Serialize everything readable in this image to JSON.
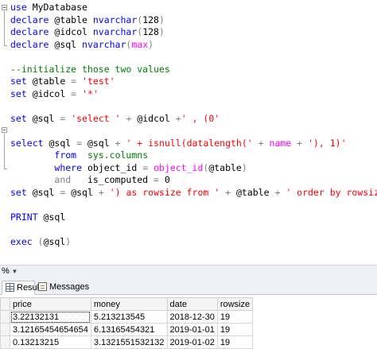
{
  "editor": {
    "lines": [
      [
        {
          "t": "kw",
          "v": "use"
        },
        {
          "t": "plain",
          "v": " MyDatabase"
        }
      ],
      [
        {
          "t": "kw",
          "v": "declare"
        },
        {
          "t": "plain",
          "v": " @table "
        },
        {
          "t": "kw",
          "v": "nvarchar"
        },
        {
          "t": "gray",
          "v": "("
        },
        {
          "t": "plain",
          "v": "128"
        },
        {
          "t": "gray",
          "v": ")"
        }
      ],
      [
        {
          "t": "kw",
          "v": "declare"
        },
        {
          "t": "plain",
          "v": " @idcol "
        },
        {
          "t": "kw",
          "v": "nvarchar"
        },
        {
          "t": "gray",
          "v": "("
        },
        {
          "t": "plain",
          "v": "128"
        },
        {
          "t": "gray",
          "v": ")"
        }
      ],
      [
        {
          "t": "kw",
          "v": "declare"
        },
        {
          "t": "plain",
          "v": " @sql "
        },
        {
          "t": "kw",
          "v": "nvarchar"
        },
        {
          "t": "gray",
          "v": "("
        },
        {
          "t": "fn",
          "v": "max"
        },
        {
          "t": "gray",
          "v": ")"
        }
      ],
      [],
      [
        {
          "t": "cmt",
          "v": "--initialize those two values"
        }
      ],
      [
        {
          "t": "kw",
          "v": "set"
        },
        {
          "t": "plain",
          "v": " @table "
        },
        {
          "t": "gray",
          "v": "="
        },
        {
          "t": "plain",
          "v": " "
        },
        {
          "t": "str",
          "v": "'test'"
        }
      ],
      [
        {
          "t": "kw",
          "v": "set"
        },
        {
          "t": "plain",
          "v": " @idcol "
        },
        {
          "t": "gray",
          "v": "="
        },
        {
          "t": "plain",
          "v": " "
        },
        {
          "t": "str",
          "v": "'*'"
        }
      ],
      [],
      [
        {
          "t": "kw",
          "v": "set"
        },
        {
          "t": "plain",
          "v": " @sql "
        },
        {
          "t": "gray",
          "v": "="
        },
        {
          "t": "plain",
          "v": " "
        },
        {
          "t": "str",
          "v": "'select '"
        },
        {
          "t": "plain",
          "v": " "
        },
        {
          "t": "gray",
          "v": "+"
        },
        {
          "t": "plain",
          "v": " @idcol "
        },
        {
          "t": "gray",
          "v": "+"
        },
        {
          "t": "str",
          "v": "' , (0'"
        }
      ],
      [],
      [
        {
          "t": "kw",
          "v": "select"
        },
        {
          "t": "plain",
          "v": " @sql "
        },
        {
          "t": "gray",
          "v": "="
        },
        {
          "t": "plain",
          "v": " @sql "
        },
        {
          "t": "gray",
          "v": "+"
        },
        {
          "t": "plain",
          "v": " "
        },
        {
          "t": "str",
          "v": "' + isnull(datalength('"
        },
        {
          "t": "plain",
          "v": " "
        },
        {
          "t": "gray",
          "v": "+"
        },
        {
          "t": "plain",
          "v": " "
        },
        {
          "t": "fn",
          "v": "name"
        },
        {
          "t": "plain",
          "v": " "
        },
        {
          "t": "gray",
          "v": "+"
        },
        {
          "t": "plain",
          "v": " "
        },
        {
          "t": "str",
          "v": "'), 1)'"
        }
      ],
      [
        {
          "t": "plain",
          "v": "        "
        },
        {
          "t": "kw",
          "v": "from"
        },
        {
          "t": "plain",
          "v": "  "
        },
        {
          "t": "sys",
          "v": "sys.columns"
        }
      ],
      [
        {
          "t": "plain",
          "v": "        "
        },
        {
          "t": "kw",
          "v": "where"
        },
        {
          "t": "plain",
          "v": " object_id "
        },
        {
          "t": "gray",
          "v": "="
        },
        {
          "t": "plain",
          "v": " "
        },
        {
          "t": "fn",
          "v": "object_id"
        },
        {
          "t": "gray",
          "v": "("
        },
        {
          "t": "plain",
          "v": "@table"
        },
        {
          "t": "gray",
          "v": ")"
        }
      ],
      [
        {
          "t": "plain",
          "v": "        "
        },
        {
          "t": "gray",
          "v": "and"
        },
        {
          "t": "plain",
          "v": "   is_computed "
        },
        {
          "t": "gray",
          "v": "="
        },
        {
          "t": "plain",
          "v": " 0"
        }
      ],
      [
        {
          "t": "kw",
          "v": "set"
        },
        {
          "t": "plain",
          "v": " @sql "
        },
        {
          "t": "gray",
          "v": "="
        },
        {
          "t": "plain",
          "v": " @sql "
        },
        {
          "t": "gray",
          "v": "+"
        },
        {
          "t": "plain",
          "v": " "
        },
        {
          "t": "str",
          "v": "') as rowsize from '"
        },
        {
          "t": "plain",
          "v": " "
        },
        {
          "t": "gray",
          "v": "+"
        },
        {
          "t": "plain",
          "v": " @table "
        },
        {
          "t": "gray",
          "v": "+"
        },
        {
          "t": "plain",
          "v": " "
        },
        {
          "t": "str",
          "v": "' order by rowsize desc'"
        }
      ],
      [],
      [
        {
          "t": "kw",
          "v": "PRINT"
        },
        {
          "t": "plain",
          "v": " @sql"
        }
      ],
      [],
      [
        {
          "t": "kw",
          "v": "exec"
        },
        {
          "t": "plain",
          "v": " "
        },
        {
          "t": "gray",
          "v": "("
        },
        {
          "t": "plain",
          "v": "@sql"
        },
        {
          "t": "gray",
          "v": ")"
        }
      ]
    ]
  },
  "zoom": {
    "value": "%"
  },
  "tabs": {
    "results": "Results",
    "messages": "Messages"
  },
  "results": {
    "columns": [
      "price",
      "money",
      "date",
      "rowsize"
    ],
    "rows": [
      [
        "3.22132131",
        "5.213213545",
        "2018-12-30",
        "19"
      ],
      [
        "3.12165454654654",
        "6.13165454321",
        "2019-01-01",
        "19"
      ],
      [
        "0.13213215",
        "3.1321551532132",
        "2019-01-02",
        "19"
      ]
    ]
  }
}
